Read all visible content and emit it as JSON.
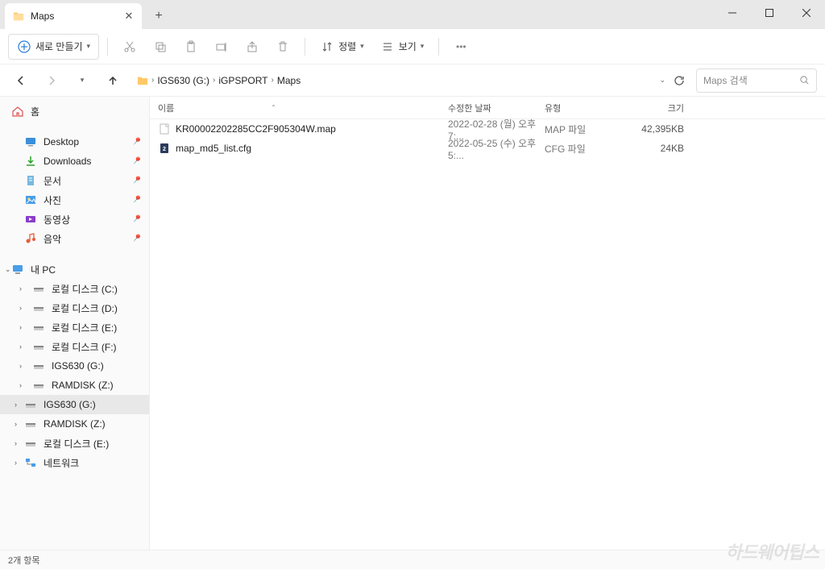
{
  "tab": {
    "title": "Maps"
  },
  "toolbar": {
    "new_label": "새로 만들기",
    "sort_label": "정렬",
    "view_label": "보기"
  },
  "breadcrumb": {
    "items": [
      "IGS630 (G:)",
      "iGPSPORT",
      "Maps"
    ]
  },
  "search": {
    "placeholder": "Maps 검색"
  },
  "sidebar": {
    "home": "홈",
    "quick": [
      {
        "label": "Desktop",
        "icon": "desktop",
        "pin": true
      },
      {
        "label": "Downloads",
        "icon": "downloads",
        "pin": true
      },
      {
        "label": "문서",
        "icon": "documents",
        "pin": true
      },
      {
        "label": "사진",
        "icon": "pictures",
        "pin": true
      },
      {
        "label": "동영상",
        "icon": "videos",
        "pin": true
      },
      {
        "label": "음악",
        "icon": "music",
        "pin": true
      }
    ],
    "pc_label": "내 PC",
    "drives": [
      "로컬 디스크 (C:)",
      "로컬 디스크 (D:)",
      "로컬 디스크 (E:)",
      "로컬 디스크 (F:)",
      "IGS630 (G:)",
      "RAMDISK (Z:)"
    ],
    "bottom": [
      {
        "label": "IGS630 (G:)",
        "active": true
      },
      {
        "label": "RAMDISK (Z:)",
        "active": false
      },
      {
        "label": "로컬 디스크 (E:)",
        "active": false
      }
    ],
    "network": "네트워크"
  },
  "columns": {
    "name": "이름",
    "date": "수정한 날짜",
    "type": "유형",
    "size": "크기"
  },
  "files": [
    {
      "name": "KR00002202285CC2F905304W.map",
      "date": "2022-02-28 (월) 오후 7:...",
      "type": "MAP 파일",
      "size": "42,395KB",
      "icon": "file"
    },
    {
      "name": "map_md5_list.cfg",
      "date": "2022-05-25 (수) 오후 5:...",
      "type": "CFG 파일",
      "size": "24KB",
      "icon": "cfg"
    }
  ],
  "status": "2개 항목",
  "watermark": "하드웨어팁스"
}
